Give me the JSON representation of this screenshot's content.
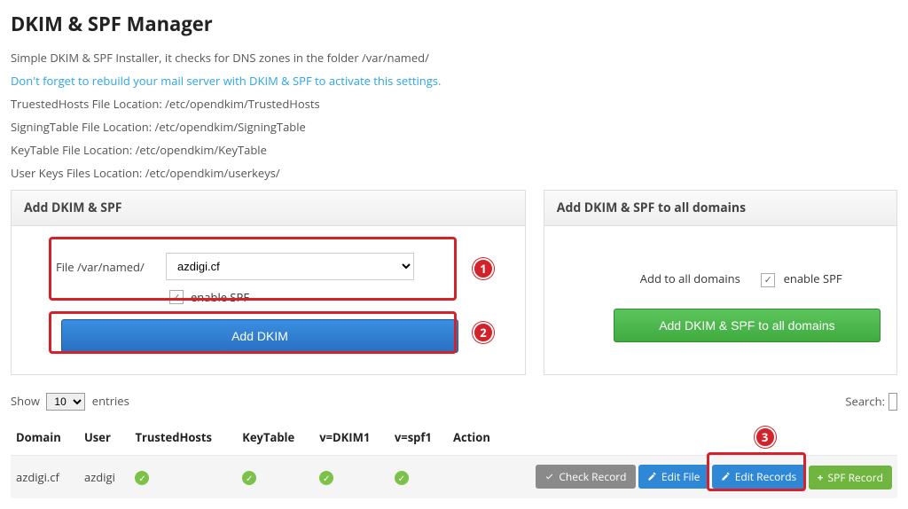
{
  "page_title": "DKIM & SPF Manager",
  "intro": {
    "line1": "Simple DKIM & SPF Installer, it checks for DNS zones in the folder /var/named/",
    "link_text": "Don't forget to rebuild your mail server with DKIM & SPF to activate this settings.",
    "trusted": "TruestedHosts File Location: /etc/opendkim/TrustedHosts",
    "signing": "SigningTable File Location: /etc/opendkim/SigningTable",
    "keytable": "KeyTable File Location: /etc/opendkim/KeyTable",
    "userkeys": "User Keys Files Location: /etc/opendkim/userkeys/"
  },
  "panel_add": {
    "title": "Add DKIM & SPF",
    "file_label": "File /var/named/",
    "domain_selected": "azdigi.cf",
    "enable_spf_label": "enable SPF",
    "button": "Add DKIM"
  },
  "panel_all": {
    "title": "Add DKIM & SPF to all domains",
    "label": "Add to all domains",
    "enable_spf_label": "enable SPF",
    "button": "Add DKIM & SPF to all domains"
  },
  "annotations": {
    "b1": "1",
    "b2": "2",
    "b3": "3"
  },
  "table_top": {
    "show": "Show",
    "entries": "entries",
    "entries_value": "10",
    "search": "Search:"
  },
  "columns": {
    "domain": "Domain",
    "user": "User",
    "trusted": "TrustedHosts",
    "keytable": "KeyTable",
    "dkim": "v=DKIM1",
    "spf": "v=spf1",
    "action": "Action"
  },
  "row": {
    "domain": "azdigi.cf",
    "user": "azdigi"
  },
  "actions": {
    "check": "Check Record",
    "edit_file": "Edit File",
    "edit_records": "Edit Records",
    "spf_record": "SPF Record"
  }
}
